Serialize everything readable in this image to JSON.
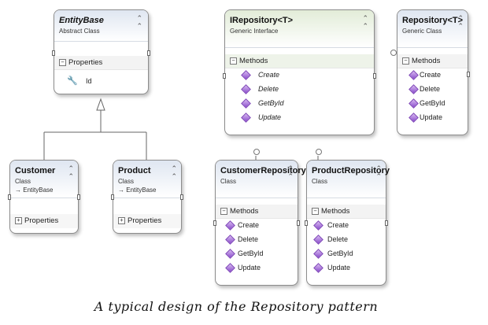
{
  "boxes": {
    "entity_base": {
      "title": "EntityBase",
      "kind": "Abstract Class",
      "section": "Properties",
      "members": [
        "Id"
      ]
    },
    "irepository": {
      "title": "IRepository<T>",
      "kind": "Generic Interface",
      "section": "Methods",
      "members": [
        "Create",
        "Delete",
        "GetById",
        "Update"
      ]
    },
    "repository": {
      "title": "Repository<T>",
      "kind": "Generic Class",
      "section": "Methods",
      "members": [
        "Create",
        "Delete",
        "GetById",
        "Update"
      ]
    },
    "customer": {
      "title": "Customer",
      "kind": "Class",
      "parent": "EntityBase",
      "section": "Properties"
    },
    "product": {
      "title": "Product",
      "kind": "Class",
      "parent": "EntityBase",
      "section": "Properties"
    },
    "customer_repository": {
      "title": "CustomerRepository",
      "kind": "Class",
      "section": "Methods",
      "members": [
        "Create",
        "Delete",
        "GetById",
        "Update"
      ]
    },
    "product_repository": {
      "title": "ProductRepository",
      "kind": "Class",
      "section": "Methods",
      "members": [
        "Create",
        "Delete",
        "GetById",
        "Update"
      ]
    }
  },
  "icons": {
    "collapse": "double-chevron-up-icon",
    "expanded": "minus-box-icon",
    "collapsed": "plus-box-icon",
    "property": "wrench-icon",
    "method": "method-diamond-icon",
    "inherits": "arrow-right-icon",
    "interface": "lollipop-icon"
  },
  "colors": {
    "header_class": "#dfe6f1",
    "header_interface": "#e2ecd8",
    "method_icon": "#8a4ecb",
    "border": "#8c8c8c"
  },
  "caption": "A typical design of the Repository pattern"
}
